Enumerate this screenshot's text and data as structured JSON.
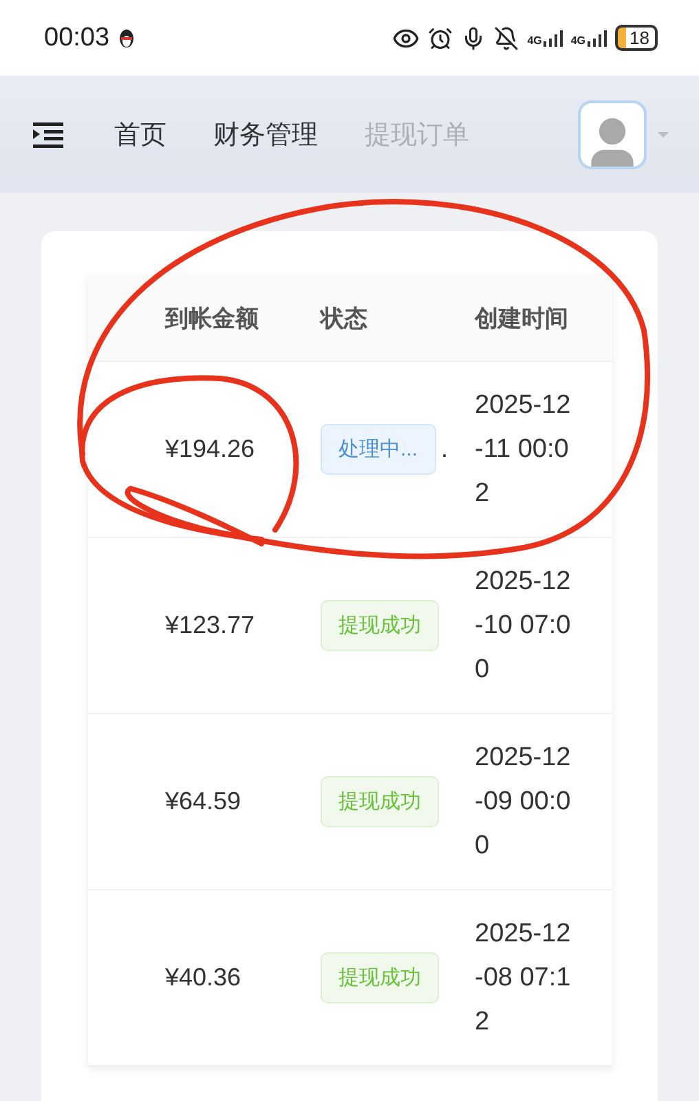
{
  "status_bar": {
    "time": "00:03",
    "network_1": "4G",
    "network_2": "4G",
    "battery": "18"
  },
  "nav": {
    "breadcrumbs": [
      {
        "label": "首页",
        "selected": false
      },
      {
        "label": "财务管理",
        "selected": false
      },
      {
        "label": "提现订单",
        "selected": true
      }
    ]
  },
  "table": {
    "columns": [
      "到帐金额",
      "状态",
      "创建时间"
    ],
    "rows": [
      {
        "amount": "¥194.26",
        "status": "处理中...",
        "kind": "processing",
        "overflow": ".",
        "created": "2025-12-11 00:02"
      },
      {
        "amount": "¥123.77",
        "status": "提现成功",
        "kind": "success",
        "created": "2025-12-10 07:00"
      },
      {
        "amount": "¥64.59",
        "status": "提现成功",
        "kind": "success",
        "created": "2025-12-09 00:00"
      },
      {
        "amount": "¥40.36",
        "status": "提现成功",
        "kind": "success",
        "created": "2025-12-08 07:12"
      }
    ]
  }
}
